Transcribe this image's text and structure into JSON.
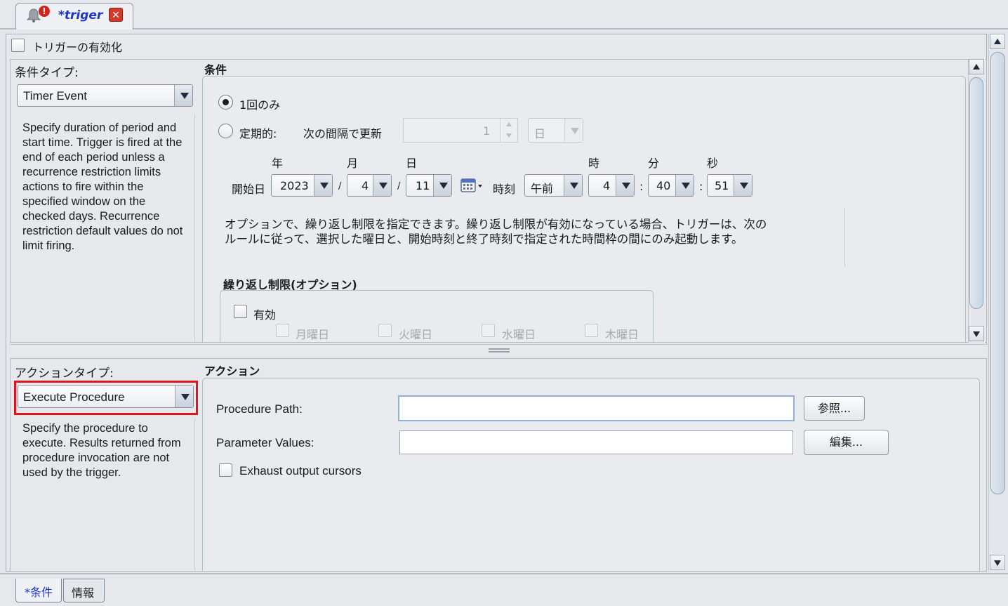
{
  "editor_tab": {
    "title": "*triger"
  },
  "trigger": {
    "enable_label": "トリガーの有効化"
  },
  "condition": {
    "type_label": "条件タイプ:",
    "type_value": "Timer Event",
    "description": "Specify duration of period and start time. Trigger is fired at the end of each period unless a recurrence restriction limits actions to fire within the specified window on the checked days. Recurrence restriction default values do not limit firing.",
    "section_title": "条件",
    "once_label": "1回のみ",
    "periodic_label": "定期的:",
    "interval_label": "次の間隔で更新",
    "interval_value": "1",
    "interval_unit": "日",
    "headers": {
      "year": "年",
      "month": "月",
      "day": "日",
      "hour": "時",
      "minute": "分",
      "second": "秒"
    },
    "start_date_label": "開始日",
    "year": "2023",
    "month": "4",
    "day": "11",
    "slash": "/",
    "time_label": "時刻",
    "ampm": "午前",
    "hour": "4",
    "minute": "40",
    "second": "51",
    "colon": ":",
    "option_text_line1": "オプションで、繰り返し制限を指定できます。繰り返し制限が有効になっている場合、トリガーは、次の",
    "option_text_line2": "ルールに従って、選択した曜日と、開始時刻と終了時刻で指定された時間枠の間にのみ起動します。",
    "recurrence_title": "繰り返し制限(オプション)",
    "recurrence_enable": "有効",
    "days": [
      "月曜日",
      "火曜日",
      "水曜日",
      "木曜日"
    ]
  },
  "action": {
    "type_label": "アクションタイプ:",
    "type_value": "Execute Procedure",
    "description": "Specify the procedure to execute. Results returned from procedure invocation are not used by the trigger.",
    "section_title": "アクション",
    "procedure_path_label": "Procedure Path:",
    "procedure_path_value": "",
    "browse_button": "参照...",
    "parameter_values_label": "Parameter Values:",
    "parameter_values_value": "",
    "edit_button": "編集...",
    "exhaust_label": "Exhaust output cursors"
  },
  "bottom_tabs": [
    "*条件",
    "情報"
  ]
}
